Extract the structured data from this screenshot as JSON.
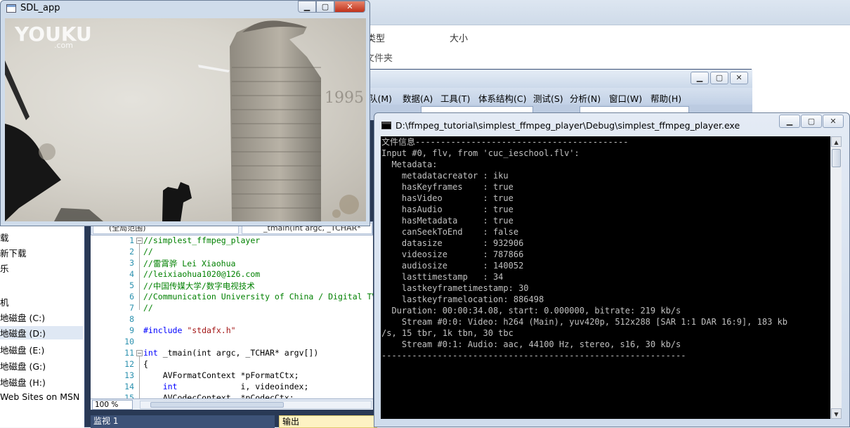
{
  "explorer": {
    "col_type": "类型",
    "col_size": "大小",
    "folder_type": "文件夹",
    "nav": [
      {
        "label": "载"
      },
      {
        "label": "新下载"
      },
      {
        "label": "乐"
      },
      {
        "label": "机"
      },
      {
        "label": "地磁盘 (C:)"
      },
      {
        "label": "地磁盘 (D:)"
      },
      {
        "label": "地磁盘 (E:)"
      },
      {
        "label": "地磁盘 (G:)"
      },
      {
        "label": "地磁盘 (H:)"
      },
      {
        "label": "Web Sites on MSN"
      }
    ]
  },
  "vs": {
    "menu": [
      "队(M)",
      "数据(A)",
      "工具(T)",
      "体系结构(C)",
      "测试(S)",
      "分析(N)",
      "窗口(W)",
      "帮助(H)"
    ],
    "nav_scope": "(全局范围)",
    "nav_member": "_tmain(int argc, _TCHAR*",
    "zoom": "100 %",
    "watch_label": "监视 1",
    "output_label": "输出",
    "code_lines": [
      {
        "n": "1",
        "text": "//simplest_ffmpeg_player"
      },
      {
        "n": "2",
        "text": "//"
      },
      {
        "n": "3",
        "text": "//雷霄骅 Lei Xiaohua"
      },
      {
        "n": "4",
        "text": "//leixiaohua1020@126.com"
      },
      {
        "n": "5",
        "text": "//中国传媒大学/数字电视技术"
      },
      {
        "n": "6",
        "text": "//Communication University of China / Digital TV"
      },
      {
        "n": "7",
        "text": "//"
      },
      {
        "n": "8",
        "text": ""
      },
      {
        "n": "9",
        "text_pp": "#include ",
        "text_str": "\"stdafx.h\""
      },
      {
        "n": "10",
        "text": ""
      },
      {
        "n": "11",
        "text_kw": "int",
        "text_rest": " _tmain(int argc, _TCHAR* argv[])"
      },
      {
        "n": "12",
        "text": "{"
      },
      {
        "n": "13",
        "text": "    AVFormatContext *pFormatCtx;"
      },
      {
        "n": "14",
        "text_kw": "    int",
        "text_rest": "             i, videoindex;"
      },
      {
        "n": "15",
        "text": "    AVCodecContext  *pCodecCtx;"
      }
    ]
  },
  "sdl": {
    "title": "SDL_app",
    "watermark": "YOUKU",
    "watermark_sub": ".com",
    "overlay_text": "1995"
  },
  "console": {
    "title": "D:\\ffmpeg_tutorial\\simplest_ffmpeg_player\\Debug\\simplest_ffmpeg_player.exe",
    "output": "文件信息------------------------------------------\nInput #0, flv, from 'cuc_ieschool.flv':\n  Metadata:\n    metadatacreator : iku\n    hasKeyframes    : true\n    hasVideo        : true\n    hasAudio        : true\n    hasMetadata     : true\n    canSeekToEnd    : false\n    datasize        : 932906\n    videosize       : 787866\n    audiosize       : 140052\n    lasttimestamp   : 34\n    lastkeyframetimestamp: 30\n    lastkeyframelocation: 886498\n  Duration: 00:00:34.08, start: 0.000000, bitrate: 219 kb/s\n    Stream #0:0: Video: h264 (Main), yuv420p, 512x288 [SAR 1:1 DAR 16:9], 183 kb\n/s, 15 tbr, 1k tbn, 30 tbc\n    Stream #0:1: Audio: aac, 44100 Hz, stereo, s16, 30 kb/s\n------------------------------------------------------------"
  }
}
